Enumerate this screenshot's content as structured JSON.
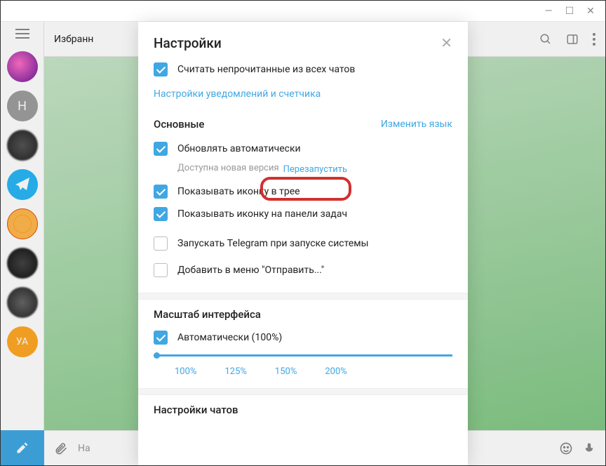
{
  "titlebar": {
    "min": "—",
    "max": "☐",
    "close": "✕"
  },
  "sidebar": {
    "avatar_h_letter": "Н",
    "avatar_ya_letter": "УА"
  },
  "topbar": {
    "title": "Избранн"
  },
  "input": {
    "placeholder": "На"
  },
  "modal": {
    "title": "Настройки",
    "top_check": "Считать непрочитанные из всех чатов",
    "notif_link": "Настройки уведомлений и счетчика",
    "section_general": "Основные",
    "change_lang": "Изменить язык",
    "auto_update": "Обновлять автоматически",
    "new_version": "Доступна новая версия",
    "restart": "Перезапустить",
    "tray_icon": "Показывать иконку в трее",
    "taskbar_icon": "Показывать иконку на панели задач",
    "autostart": "Запускать Telegram при запуске системы",
    "sendto": "Добавить в меню \"Отправить...\"",
    "section_scale": "Масштаб интерфейса",
    "scale_auto": "Автоматически (100%)",
    "scale_opts": [
      "100%",
      "125%",
      "150%",
      "200%"
    ],
    "section_chats": "Настройки чатов"
  }
}
